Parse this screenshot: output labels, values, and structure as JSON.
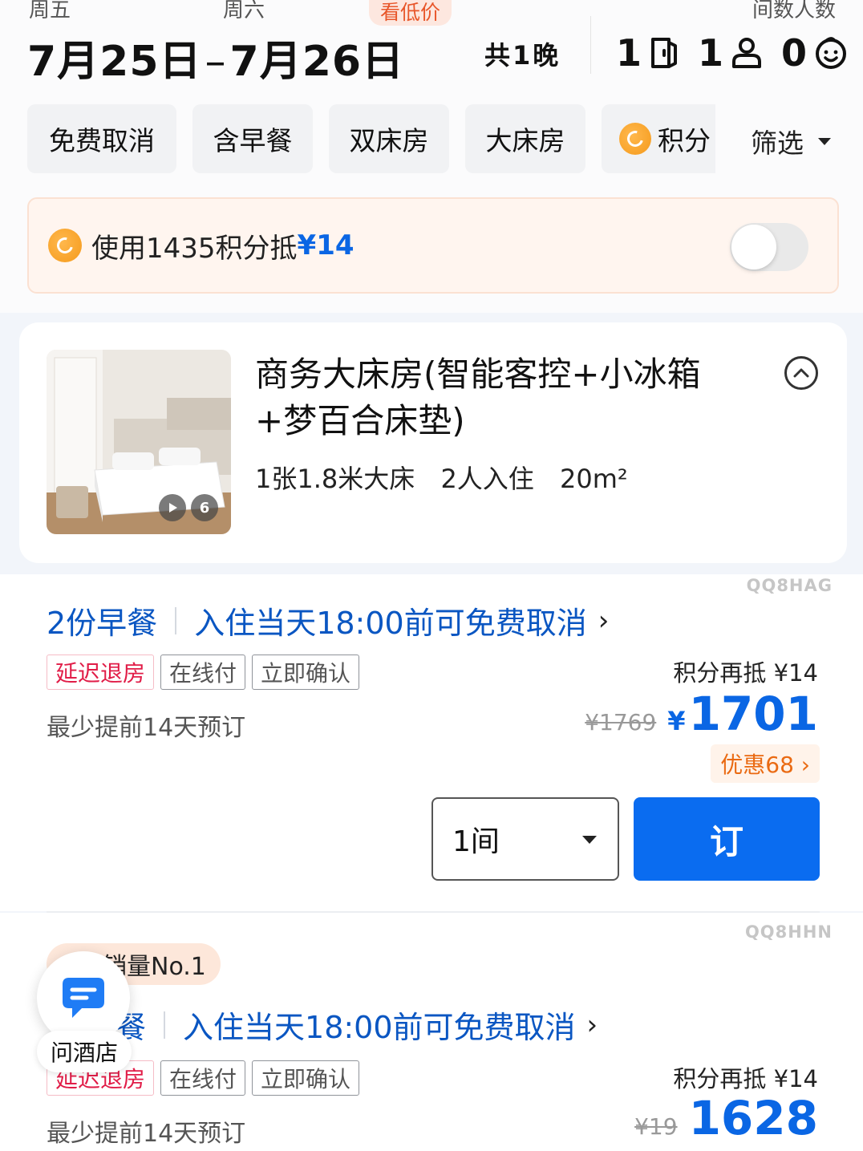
{
  "header": {
    "checkin_weekday": "周五",
    "checkout_weekday": "周六",
    "low_price_tag": "看低价",
    "rooms_guests_label": "间数人数",
    "checkin_date": "7月25日",
    "checkout_date": "7月26日",
    "date_separator": "–",
    "nights": "共1晚",
    "room_count": "1",
    "adult_count": "1",
    "child_count": "0"
  },
  "filters": {
    "chips": [
      "免费取消",
      "含早餐",
      "双床房",
      "大床房",
      "积分"
    ],
    "filter_label": "筛选"
  },
  "points_bar": {
    "text": "使用1435积分抵",
    "amount": "¥14",
    "toggle_on": false
  },
  "room": {
    "title": "商务大床房(智能客控+小冰箱+梦百合床垫)",
    "bed": "1张1.8米大床",
    "occupancy": "2人入住",
    "area": "20m²",
    "photo_count": "6"
  },
  "offers": [
    {
      "watermark": "QQ8HAG",
      "breakfast": "2份早餐",
      "cancel_policy": "入住当天18:00前可免费取消",
      "tags": [
        "延迟退房",
        "在线付",
        "立即确认"
      ],
      "advance": "最少提前14天预订",
      "points_again": "积分再抵 ¥14",
      "original_price": "¥1769",
      "currency": "¥",
      "price": "1701",
      "discount": "优惠68 ›",
      "room_qty": "1间",
      "book_label": "订"
    },
    {
      "watermark": "QQ8HHN",
      "badge": "销量No.1",
      "breakfast": "餐",
      "cancel_policy": "入住当天18:00前可免费取消",
      "tags": [
        "延迟退房",
        "在线付",
        "立即确认"
      ],
      "advance": "最少提前14天预订",
      "points_again": "积分再抵 ¥14",
      "original_price": "¥19",
      "price": "1628"
    }
  ],
  "chat": {
    "label": "问酒店"
  },
  "colors": {
    "accent_blue": "#0a6cf0",
    "price_blue": "#0a66e4",
    "orange": "#f59a1b",
    "red_tag": "#e11d48"
  }
}
